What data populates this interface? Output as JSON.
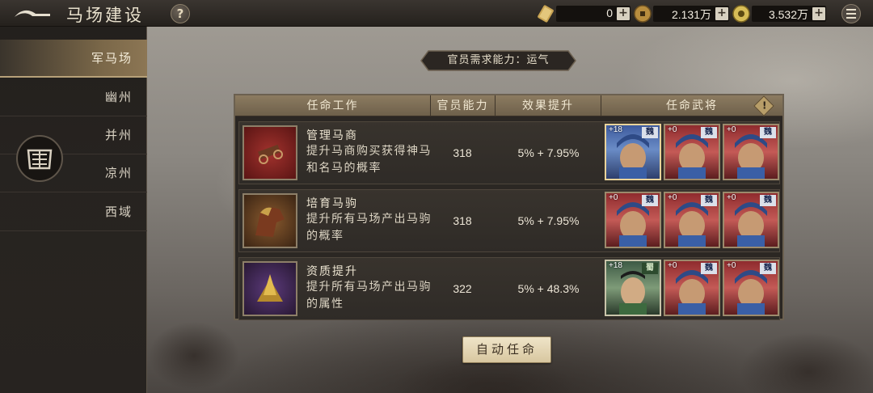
{
  "header": {
    "title": "马场建设",
    "help_label": "?",
    "resources": [
      {
        "icon": "scroll-icon",
        "value": "0"
      },
      {
        "icon": "copper-coin-icon",
        "value": "2.131万"
      },
      {
        "icon": "gold-coin-icon",
        "value": "3.532万"
      }
    ],
    "plus_label": "+"
  },
  "sidebar": {
    "items": [
      {
        "label": "军马场",
        "active": true
      },
      {
        "label": "幽州"
      },
      {
        "label": "并州"
      },
      {
        "label": "凉州"
      },
      {
        "label": "西域"
      }
    ]
  },
  "requirement": "官员需求能力：运气",
  "table": {
    "headers": [
      "任命工作",
      "官员能力",
      "效果提升",
      "任命武将"
    ],
    "info_label": "!",
    "rows": [
      {
        "name": "管理马商",
        "desc": "提升马商购买获得神马和名马的概率",
        "ability": "318",
        "effect": "5% + 7.95%",
        "generals": [
          {
            "level": "+18",
            "faction": "魏",
            "frame": "blue"
          },
          {
            "level": "+0",
            "faction": "魏",
            "frame": "red"
          },
          {
            "level": "+0",
            "faction": "魏",
            "frame": "red"
          }
        ]
      },
      {
        "name": "培育马驹",
        "desc": "提升所有马场产出马驹的概率",
        "ability": "318",
        "effect": "5% + 7.95%",
        "generals": [
          {
            "level": "+0",
            "faction": "魏",
            "frame": "red"
          },
          {
            "level": "+0",
            "faction": "魏",
            "frame": "red"
          },
          {
            "level": "+0",
            "faction": "魏",
            "frame": "red"
          }
        ]
      },
      {
        "name": "资质提升",
        "desc": "提升所有马场产出马驹的属性",
        "ability": "322",
        "effect": "5% + 48.3%",
        "generals": [
          {
            "level": "+18",
            "faction": "蜀",
            "frame": "green"
          },
          {
            "level": "+0",
            "faction": "魏",
            "frame": "red"
          },
          {
            "level": "+0",
            "faction": "魏",
            "frame": "red"
          }
        ]
      }
    ]
  },
  "auto_button": "自动任命"
}
